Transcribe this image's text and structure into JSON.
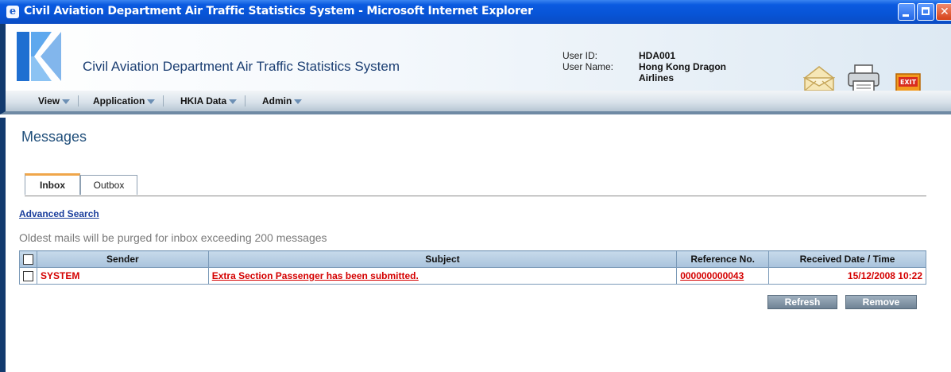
{
  "window": {
    "title": "Civil Aviation Department Air Traffic Statistics System - Microsoft Internet Explorer"
  },
  "header": {
    "app_title": "Civil Aviation Department Air Traffic Statistics System",
    "user_id_label": "User ID:",
    "user_id": "HDA001",
    "user_name_label": "User Name:",
    "user_name_line1": "Hong Kong Dragon",
    "user_name_line2": "Airlines",
    "exit_label": "EXIT"
  },
  "menu": {
    "items": [
      "View",
      "Application",
      "HKIA Data",
      "Admin"
    ]
  },
  "page": {
    "title": "Messages",
    "tabs": [
      "Inbox",
      "Outbox"
    ],
    "active_tab": "Inbox",
    "advanced_search": "Advanced Search",
    "purge_note": "Oldest mails will be purged for inbox exceeding 200 messages"
  },
  "table": {
    "headers": [
      "Sender",
      "Subject",
      "Reference No.",
      "Received Date / Time"
    ],
    "rows": [
      {
        "sender": "SYSTEM",
        "subject": "Extra Section Passenger has been submitted.",
        "reference": "000000000043",
        "received": "15/12/2008 10:22"
      }
    ]
  },
  "buttons": {
    "refresh": "Refresh",
    "remove": "Remove"
  },
  "colors": {
    "title_bar": "#0854d6",
    "accent_red": "#d40000",
    "link_blue": "#1a3e9c",
    "header_blue": "#1c3f73"
  }
}
